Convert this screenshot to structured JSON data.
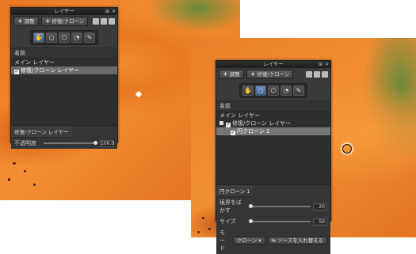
{
  "left_panel": {
    "title": "レイヤー",
    "toolbar": {
      "adjust_label": "調整",
      "retouch_clone_label": "修復/クローン"
    },
    "column_header": "名前",
    "layers": [
      {
        "label": "メイン レイヤー"
      },
      {
        "label": "修復/クローン レイヤー",
        "checked": true
      }
    ],
    "properties": {
      "title": "修復/クローン レイヤー",
      "opacity_label": "不透明度",
      "opacity_value": "100.0",
      "opacity_level": 1.0
    }
  },
  "right_panel": {
    "title": "レイヤー",
    "toolbar": {
      "adjust_label": "調整",
      "retouch_clone_label": "修復/クローン"
    },
    "column_header": "名前",
    "layers": [
      {
        "label": "メイン レイヤー"
      },
      {
        "label": "修復/クローン レイヤー",
        "checked": true
      },
      {
        "label": "円クローン 1",
        "checked": true
      }
    ],
    "properties": {
      "title": "円クローン 1",
      "feather_label": "境界をぼかす",
      "feather_value": "20",
      "size_label": "サイズ",
      "size_value": "50",
      "mode_label": "モード",
      "mode_value": "クローン",
      "swap_label": "ソースを入れ替える"
    }
  },
  "colors": {
    "panel_bg": "#3a3a3a",
    "accent": "#4c6fa0",
    "petal_orange": "#f08a2c"
  }
}
